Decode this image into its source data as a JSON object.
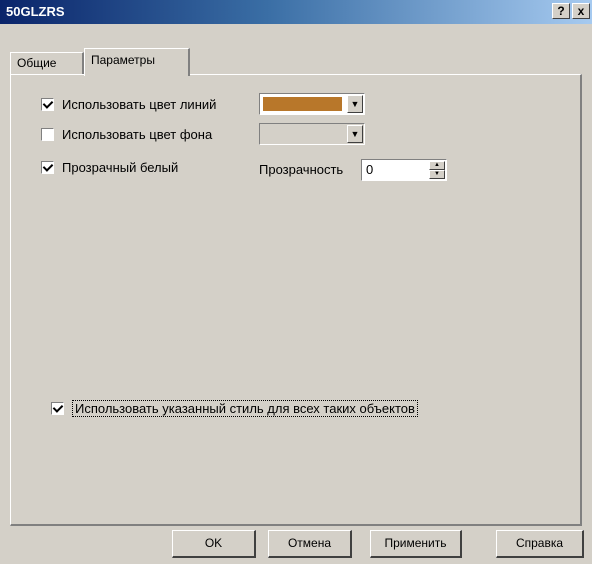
{
  "window": {
    "title": "50GLZRS",
    "help_glyph": "?",
    "close_glyph": "x"
  },
  "tabs": [
    {
      "label": "Общие",
      "active": false
    },
    {
      "label": "Параметры",
      "active": true
    }
  ],
  "params": {
    "line_color": {
      "label": "Использовать цвет линий",
      "checked": true,
      "color": "#b8772a"
    },
    "bg_color": {
      "label": "Использовать цвет фона",
      "checked": false
    },
    "transparent_white": {
      "label": "Прозрачный белый",
      "checked": true
    },
    "transparency": {
      "label": "Прозрачность",
      "value": "0"
    },
    "apply_all": {
      "label": "Использовать указанный стиль для всех таких объектов",
      "checked": true
    }
  },
  "buttons": {
    "ok": "OK",
    "cancel": "Отмена",
    "apply": "Применить",
    "help": "Справка"
  }
}
